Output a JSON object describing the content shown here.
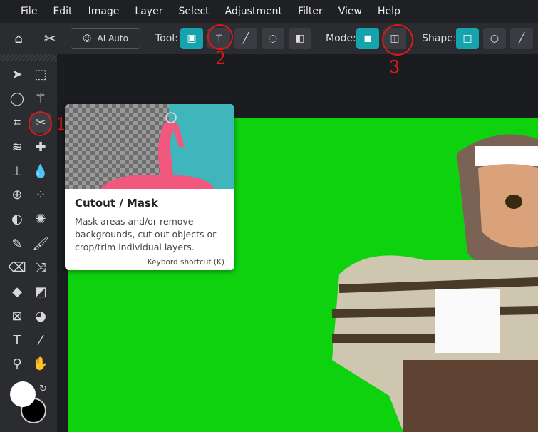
{
  "menu": [
    "File",
    "Edit",
    "Image",
    "Layer",
    "Select",
    "Adjustment",
    "Filter",
    "View",
    "Help"
  ],
  "toolbar": {
    "ai_auto": "AI Auto",
    "tool_label": "Tool:",
    "mode_label": "Mode:",
    "shape_label": "Shape:"
  },
  "tooltip": {
    "title": "Cutout / Mask",
    "description": "Mask areas and/or remove backgrounds, cut out objects or crop/trim individual layers.",
    "shortcut": "Keybord shortcut (K)"
  },
  "annotations": [
    "1",
    "2",
    "3"
  ],
  "colors": {
    "accent": "#15a3ad",
    "canvas": "#0fd20f",
    "annotation": "#e01818"
  }
}
